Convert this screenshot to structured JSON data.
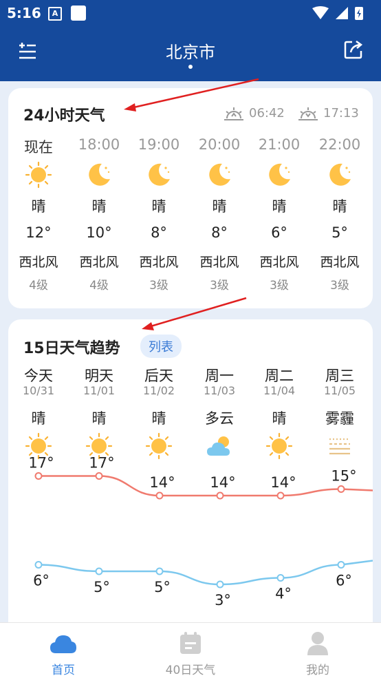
{
  "status_bar": {
    "time": "5:16",
    "notification_letter": "A"
  },
  "header": {
    "city": "北京市"
  },
  "hourly": {
    "title": "24小时天气",
    "sunrise": "06:42",
    "sunset": "17:13",
    "items": [
      {
        "time": "现在",
        "icon": "sun-icon",
        "cond": "晴",
        "temp": "12°",
        "wind": "西北风",
        "level": "4级"
      },
      {
        "time": "18:00",
        "icon": "moon-icon",
        "cond": "晴",
        "temp": "10°",
        "wind": "西北风",
        "level": "4级"
      },
      {
        "time": "19:00",
        "icon": "moon-icon",
        "cond": "晴",
        "temp": "8°",
        "wind": "西北风",
        "level": "3级"
      },
      {
        "time": "20:00",
        "icon": "moon-icon",
        "cond": "晴",
        "temp": "8°",
        "wind": "西北风",
        "level": "3级"
      },
      {
        "time": "21:00",
        "icon": "moon-icon",
        "cond": "晴",
        "temp": "6°",
        "wind": "西北风",
        "level": "3级"
      },
      {
        "time": "22:00",
        "icon": "moon-icon",
        "cond": "晴",
        "temp": "5°",
        "wind": "西北风",
        "level": "3级"
      }
    ]
  },
  "daily": {
    "title": "15日天气趋势",
    "tag": "列表",
    "items": [
      {
        "day": "今天",
        "date": "10/31",
        "cond": "晴",
        "icon": "sun-icon",
        "high": "17°",
        "low": "6°"
      },
      {
        "day": "明天",
        "date": "11/01",
        "cond": "晴",
        "icon": "sun-icon",
        "high": "17°",
        "low": "5°"
      },
      {
        "day": "后天",
        "date": "11/02",
        "cond": "晴",
        "icon": "sun-icon",
        "high": "14°",
        "low": "5°"
      },
      {
        "day": "周一",
        "date": "11/03",
        "cond": "多云",
        "icon": "cloud-sun-icon",
        "high": "14°",
        "low": "3°"
      },
      {
        "day": "周二",
        "date": "11/04",
        "cond": "晴",
        "icon": "sun-icon",
        "high": "14°",
        "low": "4°"
      },
      {
        "day": "周三",
        "date": "11/05",
        "cond": "雾霾",
        "icon": "haze-icon",
        "high": "15°",
        "low": "6°"
      }
    ],
    "high_color": "#f07a6e",
    "low_color": "#7cc8ee"
  },
  "bottom_nav": [
    {
      "label": "首页",
      "icon": "cloud-icon",
      "active": true
    },
    {
      "label": "40日天气",
      "icon": "calendar-icon",
      "active": false
    },
    {
      "label": "我的",
      "icon": "user-icon",
      "active": false
    }
  ],
  "colors": {
    "header": "#154a9c",
    "accent": "#3a86e0",
    "annotation_arrow": "#e02020"
  }
}
